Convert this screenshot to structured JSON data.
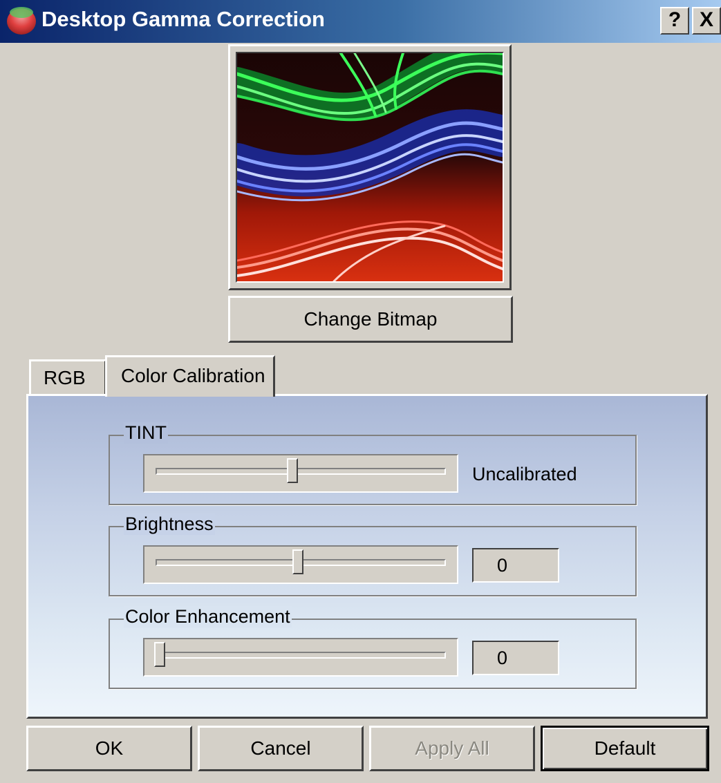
{
  "window": {
    "title": "Desktop Gamma Correction",
    "help_label": "?",
    "close_label": "X"
  },
  "preview": {
    "change_bitmap_label": "Change Bitmap"
  },
  "tabs": [
    {
      "label": "RGB",
      "selected": false
    },
    {
      "label": "Color Calibration",
      "selected": true
    }
  ],
  "groups": {
    "tint": {
      "label": "TINT",
      "slider_value": 0.47,
      "status": "Uncalibrated"
    },
    "brightness": {
      "label": "Brightness",
      "slider_value": 0.49,
      "value": "0"
    },
    "color_enhancement": {
      "label": "Color Enhancement",
      "slider_value": 0.0,
      "value": "0"
    }
  },
  "buttons": {
    "ok": "OK",
    "cancel": "Cancel",
    "apply_all": "Apply All",
    "default": "Default"
  },
  "icons": {
    "app": "gamma-ball-icon",
    "help": "help-icon",
    "close": "close-icon"
  },
  "colors": {
    "titlebar": "#0a246a",
    "dialog_bg": "#d4d0c8",
    "panel_top": "#a9b7d6",
    "panel_bottom": "#eef5fb"
  }
}
